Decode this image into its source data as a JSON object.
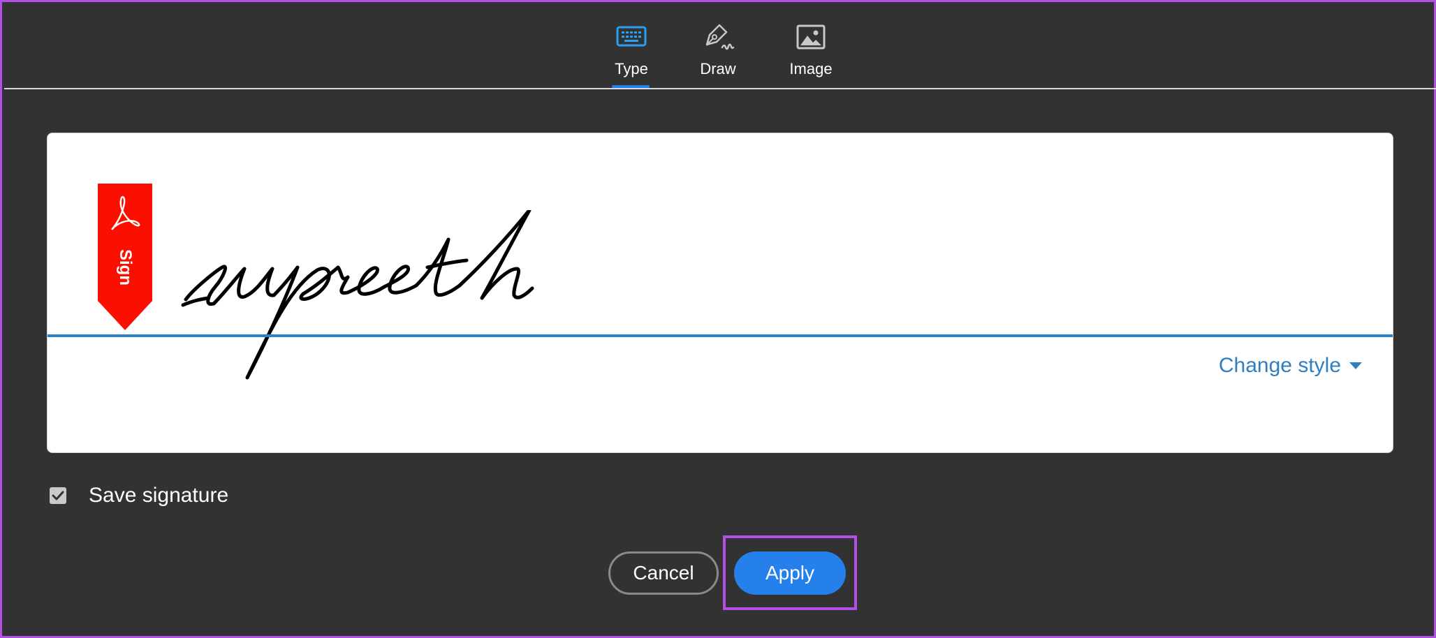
{
  "tabs": [
    {
      "label": "Type",
      "icon": "keyboard-icon",
      "active": true
    },
    {
      "label": "Draw",
      "icon": "pen-draw-icon",
      "active": false
    },
    {
      "label": "Image",
      "icon": "image-icon",
      "active": false
    }
  ],
  "signature": {
    "badge_text": "Sign",
    "typed_text": "supreeth",
    "change_style_label": "Change style"
  },
  "save_signature": {
    "label": "Save signature",
    "checked": true
  },
  "buttons": {
    "cancel_label": "Cancel",
    "apply_label": "Apply"
  },
  "colors": {
    "background": "#323232",
    "accent": "#2680eb",
    "link": "#2d7fc1",
    "adobe_red": "#fa0f00",
    "highlight": "#b44fe6"
  }
}
